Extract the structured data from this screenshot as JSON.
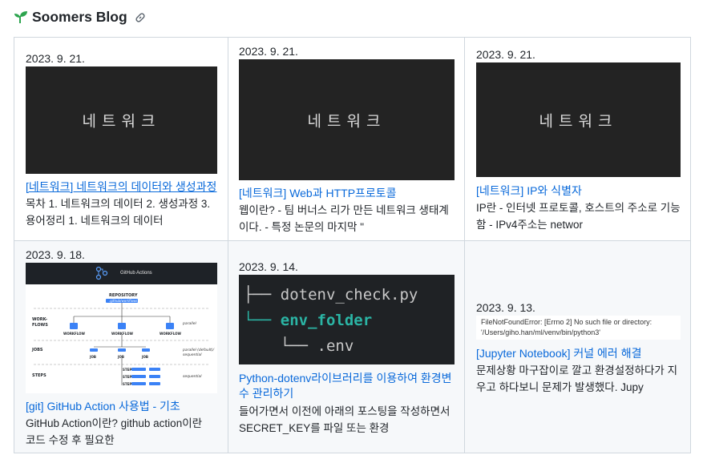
{
  "header": {
    "title": "Soomers Blog",
    "logo_icon": "sprout-icon",
    "link_icon": "link-icon"
  },
  "posts": [
    {
      "date": "2023. 9. 21.",
      "thumb_text": "네트워크",
      "title": "[네트워크] 네트워크의 데이터와 생성과정",
      "excerpt_lines": [
        "목차 1. 네트워크의 데이터 2. 생성과정 3.",
        "용어정리 1. 네트워크의 데이터"
      ]
    },
    {
      "date": "2023. 9. 21.",
      "thumb_text": "네트워크",
      "title": "[네트워크] Web과 HTTP프로토콜",
      "excerpt_lines": [
        "웹이란? - 팀 버너스 리가 만든 네트워크 생태계",
        "이다. - 특정 논문의 마지막 \""
      ]
    },
    {
      "date": "2023. 9. 21.",
      "thumb_text": "네트워크",
      "title": "[네트워크] IP와 식별자",
      "excerpt_lines": [
        "IP란 - 인터넷 프로토콜, 호스트의 주소로 기능",
        "함 - IPv4주소는 networ"
      ]
    },
    {
      "date": "2023. 9. 18.",
      "thumb": {
        "header": "GitHub Actions",
        "repository": "REPOSITORY",
        "event": ".github/workflows",
        "workflow": "WORKFLOW",
        "job": "JOB",
        "step": "STEP",
        "row_labels": [
          "WORK-",
          "FLOWS",
          "JOBS",
          "STEPS"
        ],
        "notes": [
          "parallel",
          "parallel (default)/",
          "sequential",
          "sequential"
        ]
      },
      "title": "[git] GitHub Action 사용법 - 기초",
      "excerpt_lines": [
        "GitHub Action이란? github action이란",
        "코드 수정 후 필요한"
      ]
    },
    {
      "date": "2023. 9. 14.",
      "thumb": {
        "lines": [
          "├── dotenv_check.py",
          "└── env_folder",
          "    └── .env"
        ]
      },
      "title_lines": [
        "Python-dotenv라이브러리를 이용하여 환경변",
        "수 관리하기"
      ],
      "excerpt_lines": [
        "들어가면서 이전에 아래의 포스팅을 작성하면서",
        "SECRET_KEY를 파일 또는 환경"
      ]
    },
    {
      "date": "2023. 9. 13.",
      "thumb": {
        "lines": [
          "FileNotFoundError: [Errno 2] No such file or directory:",
          "'/Users/giho.han/ml/venv/bin/python3'"
        ]
      },
      "title": "[Jupyter Notebook] 커널 에러 해결",
      "excerpt_lines": [
        "문제상황 마구잡이로 깔고 환경설정하다가 지",
        "우고 하다보니 문제가 발생했다. Jupy"
      ]
    }
  ],
  "colors": {
    "link": "#0969da",
    "sprout": "#2da44e",
    "border": "#d0d7de",
    "env_folder": "#2bb5a5"
  }
}
